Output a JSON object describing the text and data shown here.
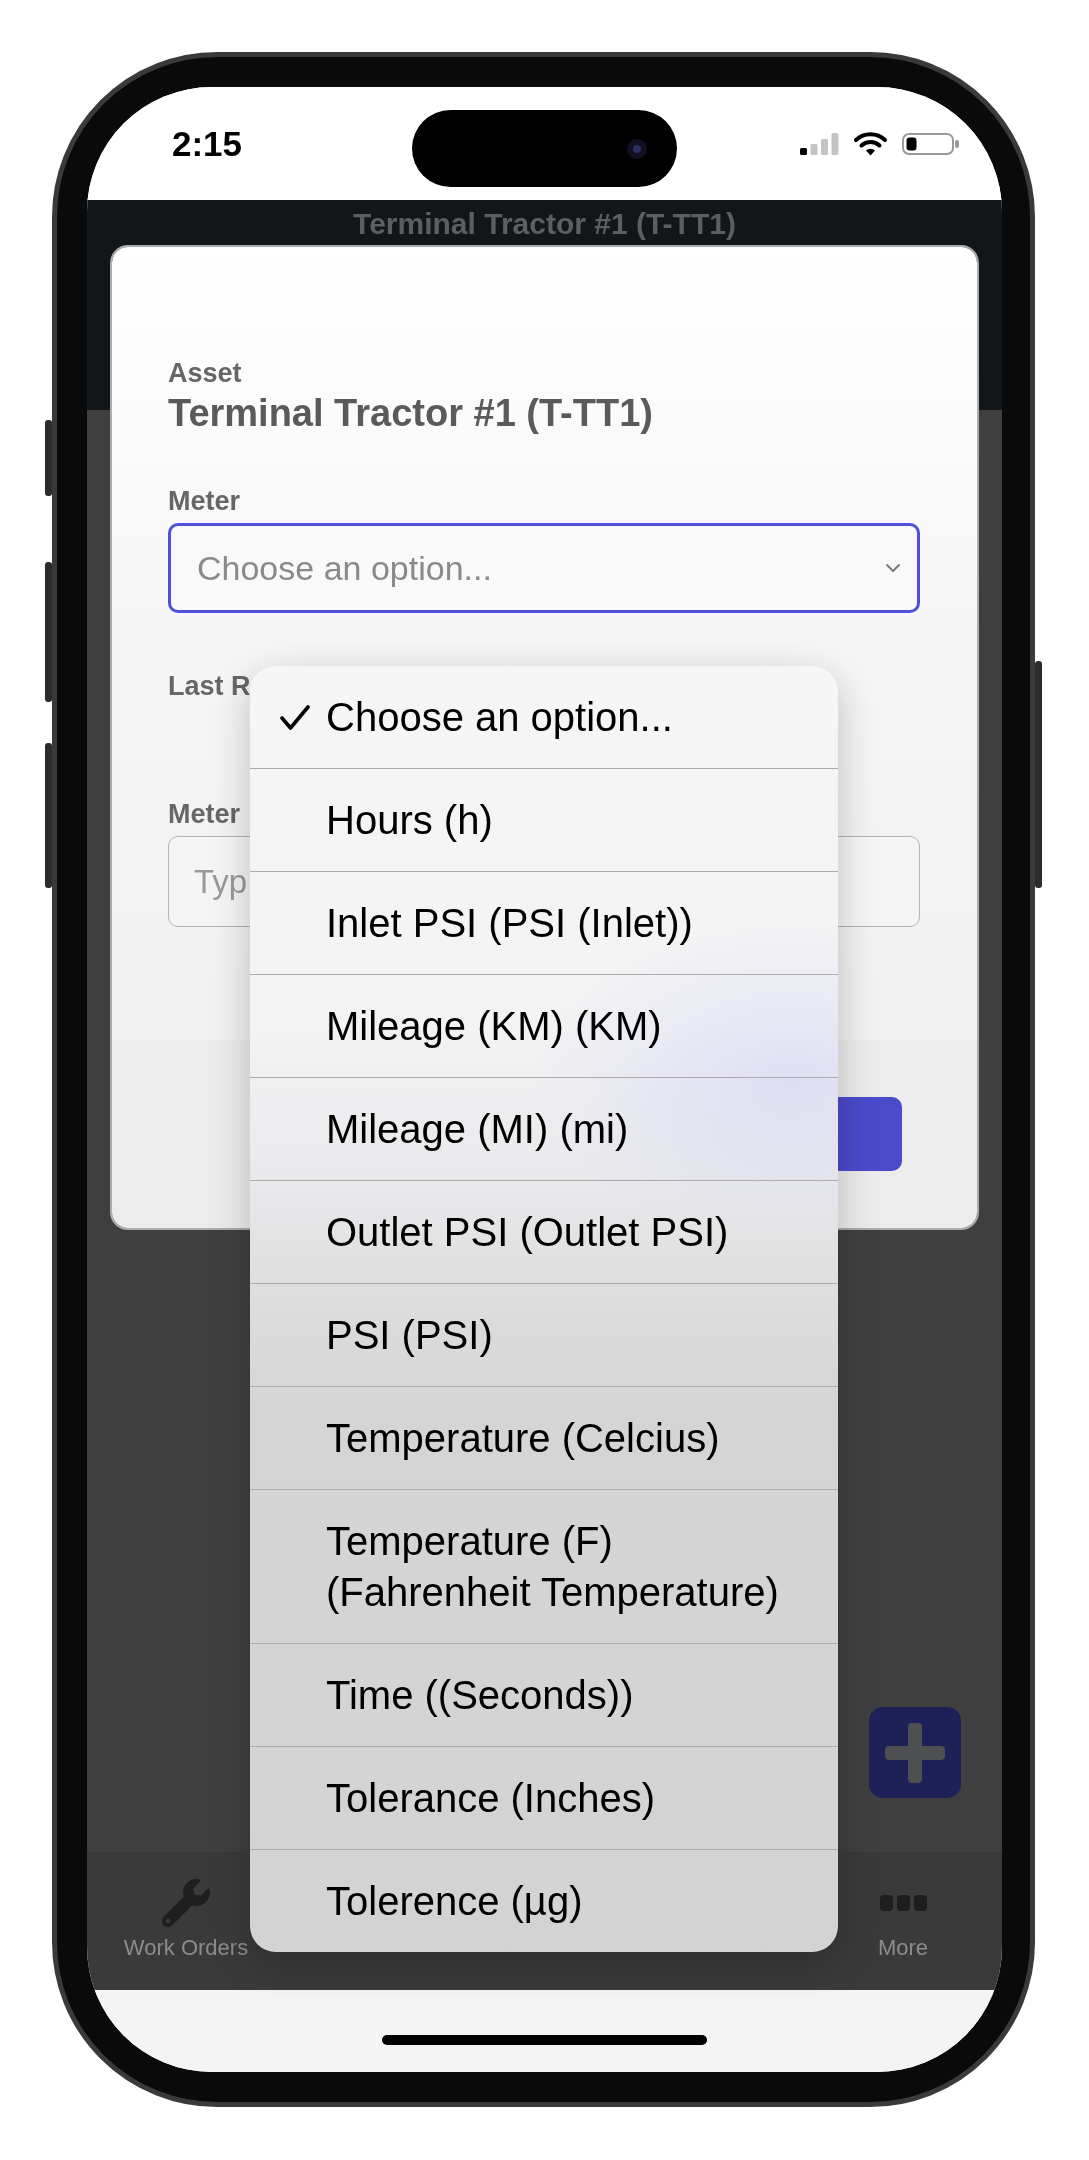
{
  "status_bar": {
    "time": "2:15"
  },
  "header": {
    "title": "Terminal Tractor #1 (T-TT1)"
  },
  "modal": {
    "asset": {
      "label": "Asset",
      "value": "Terminal Tractor #1 (T-TT1)"
    },
    "meter": {
      "label": "Meter",
      "placeholder": "Choose an option...",
      "focused": true
    },
    "last_reading": {
      "label": "Last R"
    },
    "meter_reading": {
      "label": "Meter",
      "placeholder": "Typ"
    }
  },
  "dropdown": {
    "options": [
      {
        "label": "Choose an option...",
        "selected": true
      },
      {
        "label": "Hours (h)",
        "selected": false
      },
      {
        "label": "Inlet PSI (PSI (Inlet))",
        "selected": false
      },
      {
        "label": "Mileage (KM) (KM)",
        "selected": false
      },
      {
        "label": "Mileage (MI) (mi)",
        "selected": false
      },
      {
        "label": "Outlet PSI (Outlet PSI)",
        "selected": false
      },
      {
        "label": "PSI (PSI)",
        "selected": false
      },
      {
        "label": "Temperature (Celcius)",
        "selected": false
      },
      {
        "label": "Temperature (F) (Fahrenheit Temperature)",
        "selected": false
      },
      {
        "label": "Time ((Seconds))",
        "selected": false
      },
      {
        "label": "Tolerance (Inches)",
        "selected": false
      },
      {
        "label": "Tolerence (µg)",
        "selected": false
      }
    ]
  },
  "tab_bar": {
    "items": [
      {
        "label": "Work Orders"
      },
      {
        "label": "More"
      }
    ]
  }
}
